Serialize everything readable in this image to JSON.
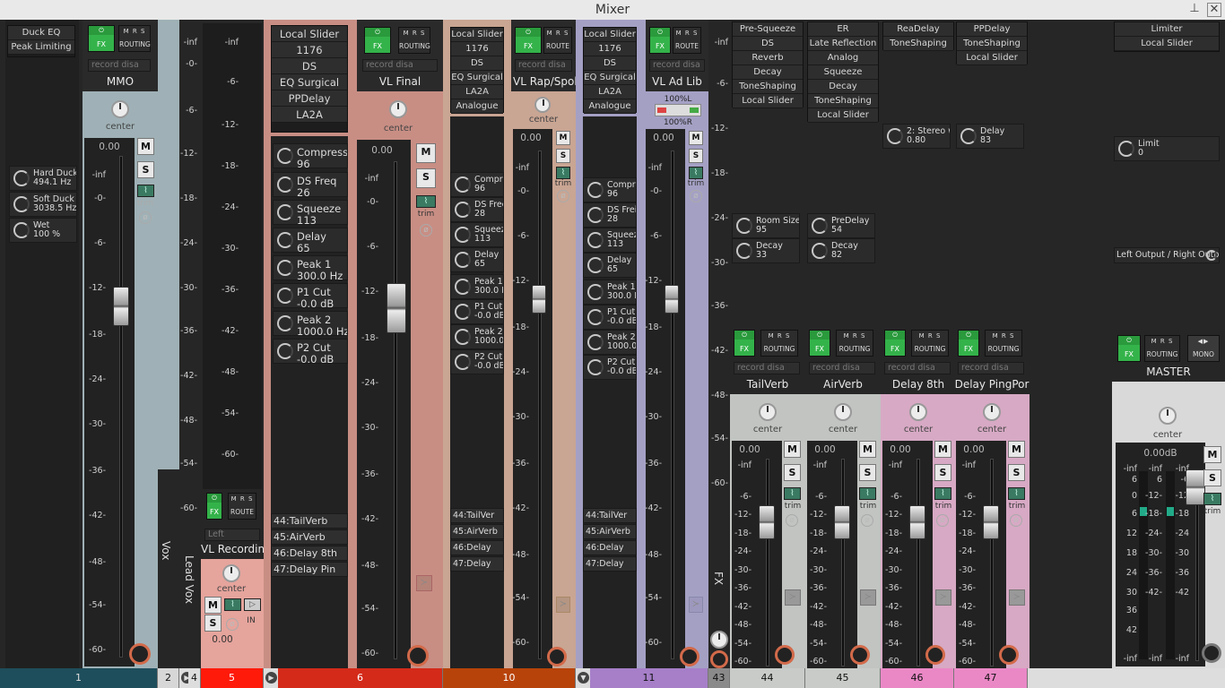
{
  "window": {
    "title": "Mixer",
    "pin_icon": "pin-icon",
    "close_icon": "close-icon"
  },
  "common": {
    "fx": "FX",
    "power": "⏻",
    "mrs": "M R S",
    "routing": "ROUTING",
    "route": "ROUTE",
    "record_disabled": "record disa",
    "center": "center",
    "m": "M",
    "s": "S",
    "trim": "trim",
    "zero": "0.00",
    "phase": "ø",
    "mono": "MONO",
    "minus_inf": "-inf",
    "left": "Left",
    "in": "IN"
  },
  "strips": {
    "t1": {
      "slots": [
        "Duck EQ",
        "Peak Limiting"
      ],
      "params": [
        {
          "name": "Hard Duck",
          "value": "494.1 Hz"
        },
        {
          "name": "Soft Duck",
          "value": "3038.5 Hz"
        },
        {
          "name": "Wet",
          "value": "100 %"
        }
      ]
    },
    "mmo": {
      "name": "MMO",
      "volume": "0.00"
    },
    "t2": {
      "vertical_name": "Vox",
      "number": "2"
    },
    "t4": {
      "vertical_name": "Lead Vox",
      "number": "4"
    },
    "t5": {
      "name": "VL Recordin",
      "volume": "0.00",
      "input": "Left",
      "number": "5"
    },
    "t6": {
      "name": "VL Final",
      "volume": "0.00",
      "number": "6",
      "slots": [
        "Local Slider",
        "1176",
        "DS",
        "EQ Surgical",
        "PPDelay",
        "LA2A"
      ],
      "params": [
        {
          "name": "Compress",
          "value": "96"
        },
        {
          "name": "DS Freq",
          "value": "26"
        },
        {
          "name": "Squeeze",
          "value": "113"
        },
        {
          "name": "Delay",
          "value": "65"
        },
        {
          "name": "Peak 1",
          "value": "300.0 Hz"
        },
        {
          "name": "P1 Cut",
          "value": "-0.0 dB"
        },
        {
          "name": "Peak 2",
          "value": "1000.0 Hz"
        },
        {
          "name": "P2 Cut",
          "value": "-0.0 dB"
        }
      ],
      "sends": [
        "44:TailVerb",
        "45:AirVerb",
        "46:Delay 8th",
        "47:Delay Pin"
      ]
    },
    "t10": {
      "name": "VL Rap/Spok",
      "volume": "0.00",
      "number": "10",
      "slots": [
        "Local Slider",
        "1176",
        "DS",
        "EQ Surgical",
        "LA2A",
        "Analogue"
      ],
      "params": [
        {
          "name": "Compre",
          "value": "96"
        },
        {
          "name": "DS Frec",
          "value": "28"
        },
        {
          "name": "Squeeze",
          "value": "113"
        },
        {
          "name": "Delay",
          "value": "65"
        },
        {
          "name": "Peak 1",
          "value": "300.0 H"
        },
        {
          "name": "P1 Cut",
          "value": "-0.0 dB"
        },
        {
          "name": "Peak 2",
          "value": "1000.0 I"
        },
        {
          "name": "P2 Cut",
          "value": "-0.0 dB"
        }
      ],
      "sends": [
        "44:TailVer",
        "45:AirVerb",
        "46:Delay",
        "47:Delay"
      ]
    },
    "t11": {
      "name": "VL Ad Lib",
      "volume": "0.00",
      "number": "11",
      "width_l": "100%L",
      "width_r": "100%R",
      "slots": [
        "Local Slider",
        "1176",
        "DS",
        "EQ Surgical",
        "LA2A",
        "Analogue"
      ],
      "params": [
        {
          "name": "Compre",
          "value": "96"
        },
        {
          "name": "DS Frei",
          "value": "28"
        },
        {
          "name": "Squeez",
          "value": "113"
        },
        {
          "name": "Delay",
          "value": "65"
        },
        {
          "name": "Peak 1",
          "value": "300.0 H"
        },
        {
          "name": "P1 Cut",
          "value": "-0.0 dB"
        },
        {
          "name": "Peak 2",
          "value": "1000.0 I"
        },
        {
          "name": "P2 Cut",
          "value": "-0.0 dB"
        }
      ],
      "sends": [
        "44:TailVer",
        "45:AirVerb",
        "46:Delay",
        "47:Delay"
      ]
    },
    "t43": {
      "vertical_name": "FX",
      "number": "43"
    },
    "t44": {
      "name": "TailVerb",
      "volume": "0.00",
      "number": "44",
      "slots": [
        "Pre-Squeeze",
        "DS",
        "Reverb",
        "Decay",
        "ToneShaping",
        "Local Slider"
      ],
      "params": [
        {
          "name": "Room Size",
          "value": "95"
        },
        {
          "name": "Decay",
          "value": "33"
        }
      ]
    },
    "t45": {
      "name": "AirVerb",
      "volume": "0.00",
      "number": "45",
      "slots": [
        "ER",
        "Late Reflection",
        "Analog",
        "Squeeze",
        "Decay",
        "ToneShaping",
        "Local Slider"
      ],
      "params": [
        {
          "name": "PreDelay",
          "value": "54"
        },
        {
          "name": "Decay",
          "value": "82"
        }
      ]
    },
    "t46": {
      "name": "Delay 8th",
      "volume": "0.00",
      "number": "46",
      "slots": [
        "ReaDelay",
        "ToneShaping"
      ],
      "params": [
        {
          "name": "2: Stereo wi",
          "value": "0.80"
        }
      ]
    },
    "t47": {
      "name": "Delay PingPor",
      "volume": "0.00",
      "number": "47",
      "slots": [
        "PPDelay",
        "ToneShaping",
        "Local Slider"
      ],
      "params": [
        {
          "name": "Delay",
          "value": "83"
        }
      ]
    },
    "master": {
      "name": "MASTER",
      "volume": "0.00dB",
      "slots": [
        "Limiter",
        "Local Slider"
      ],
      "params": [
        {
          "name": "Limit",
          "value": "0"
        },
        {
          "name": "Left Output / Right Outp",
          "value": ""
        }
      ]
    }
  },
  "scales": {
    "main": [
      "-inf",
      "-0-",
      "-6-",
      "-12-",
      "-18-",
      "-24-",
      "-30-",
      "-36-",
      "-42-",
      "-48-",
      "-54-",
      "-60-"
    ],
    "fx": [
      "-inf",
      "-6-",
      "-12-",
      "-18-",
      "-24-",
      "-30-",
      "-36-",
      "-42-",
      "-48-",
      "-54-",
      "-60-"
    ],
    "fx_left": [
      "-6-",
      "-12-",
      "-18-",
      "-24-",
      "-30-",
      "-36-",
      "-42-",
      "-48-",
      "-54-",
      "-60-"
    ],
    "master_left": [
      "-inf",
      "6",
      "0",
      "6",
      "12",
      "18",
      "24",
      "30",
      "36",
      "42",
      "-inf"
    ],
    "master_right": [
      "-inf",
      "6",
      "-12-",
      "-18-",
      "-24-",
      "-30-",
      "-36-",
      "-42-",
      "-inf"
    ]
  },
  "colors": {
    "blue_strip": "#9fb1b6",
    "salmon": "#e5a49c",
    "rose": "#c88e84",
    "tan": "#c9a593",
    "lilac": "#a4a0c4",
    "pink": "#d7a9c4",
    "gray": "#c1c4c1",
    "fx_green": "#34b34a"
  }
}
